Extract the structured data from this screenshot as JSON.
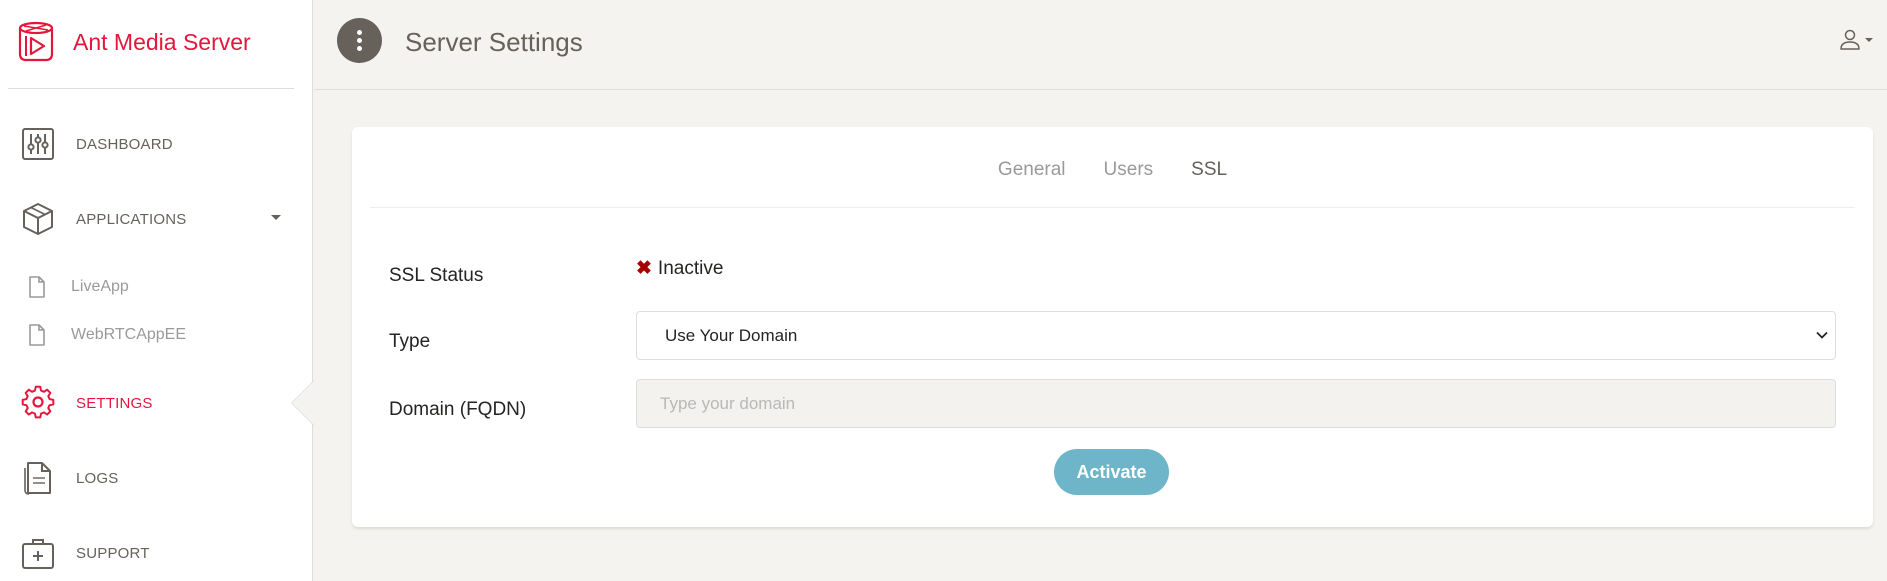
{
  "brand": {
    "name": "Ant Media Server",
    "logo_icon": "ant-media-logo-icon",
    "color": "#e5163b"
  },
  "sidebar": {
    "items": [
      {
        "label": "DASHBOARD",
        "icon": "sliders-icon"
      },
      {
        "label": "APPLICATIONS",
        "icon": "box-icon"
      },
      {
        "label": "SETTINGS",
        "icon": "gear-icon",
        "active": true
      },
      {
        "label": "LOGS",
        "icon": "document-icon"
      },
      {
        "label": "SUPPORT",
        "icon": "first-aid-kit-icon"
      }
    ],
    "applications": [
      {
        "label": "LiveApp",
        "icon": "file-icon"
      },
      {
        "label": "WebRTCAppEE",
        "icon": "file-icon"
      }
    ]
  },
  "header": {
    "title": "Server Settings",
    "menu_icon": "vertical-dots-icon",
    "user_icon": "user-icon"
  },
  "tabs": [
    {
      "label": "General"
    },
    {
      "label": "Users"
    },
    {
      "label": "SSL",
      "active": true
    }
  ],
  "ssl": {
    "status_label": "SSL Status",
    "status_value": "Inactive",
    "status_color": "#a60000",
    "type_label": "Type",
    "type_value": "Use Your Domain",
    "domain_label": "Domain (FQDN)",
    "domain_placeholder": "Type your domain",
    "domain_value": "",
    "activate_label": "Activate",
    "activate_color": "#6eb5c9"
  }
}
